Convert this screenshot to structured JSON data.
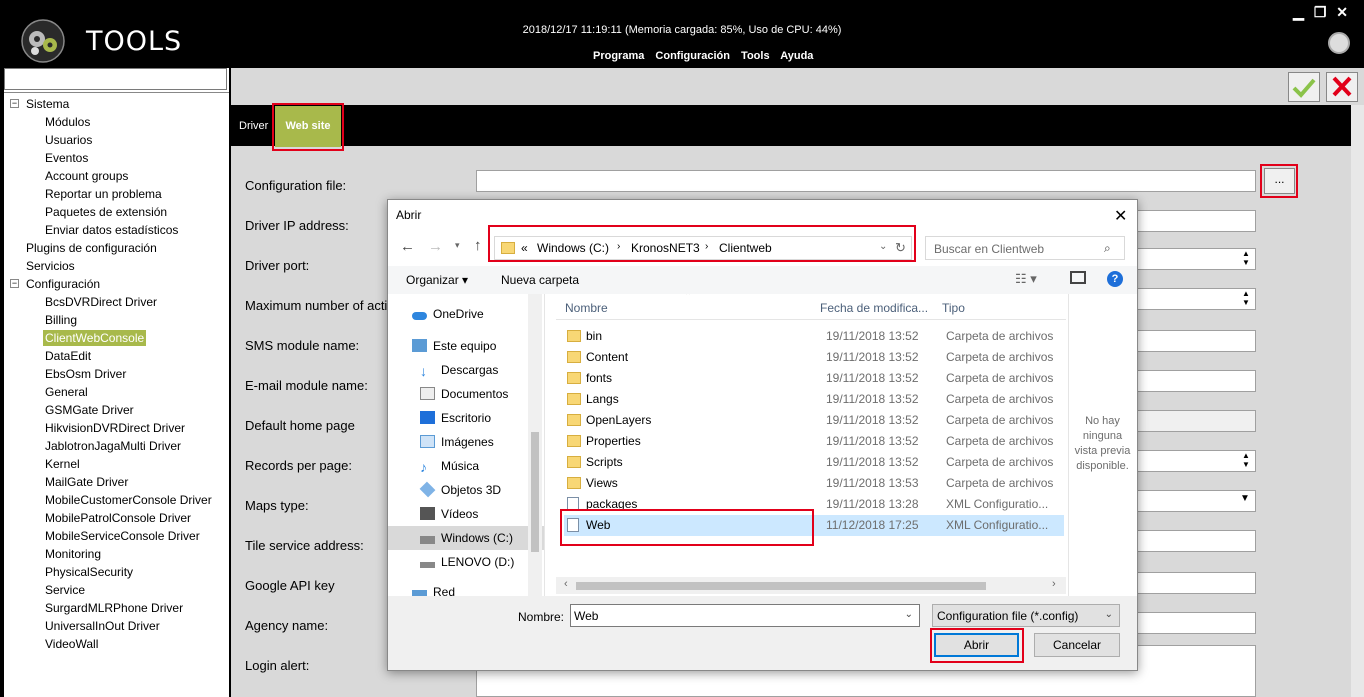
{
  "header": {
    "app_title": "TOOLS",
    "datetime_status": "2018/12/17 11:19:11 (Memoria cargada: 85%, Uso de CPU: 44%)",
    "menu": [
      "Programa",
      "Configuración",
      "Tools",
      "Ayuda"
    ]
  },
  "tree": {
    "sistema": {
      "label": "Sistema",
      "children": [
        "Módulos",
        "Usuarios",
        "Eventos",
        "Account groups",
        "Reportar un problema",
        "Paquetes de extensión",
        "Enviar datos estadísticos"
      ]
    },
    "plugins": "Plugins de configuración",
    "servicios": "Servicios",
    "configuracion": {
      "label": "Configuración",
      "children": [
        "BcsDVRDirect Driver",
        "Billing",
        "ClientWebConsole",
        "DataEdit",
        "EbsOsm Driver",
        "General",
        "GSMGate Driver",
        "HikvisionDVRDirect Driver",
        "JablotronJagaMulti Driver",
        "Kernel",
        "MailGate Driver",
        "MobileCustomerConsole Driver",
        "MobilePatrolConsole Driver",
        "MobileServiceConsole Driver",
        "Monitoring",
        "PhysicalSecurity",
        "Service",
        "SurgardMLRPhone Driver",
        "UniversalInOut Driver",
        "VideoWall"
      ]
    },
    "selected": "ClientWebConsole"
  },
  "tabs": {
    "driver": "Driver",
    "website": "Web site"
  },
  "form": {
    "labels": [
      "Configuration file:",
      "Driver IP address:",
      "Driver port:",
      "Maximum number of acti",
      "SMS module name:",
      "E-mail module name:",
      "Default home page",
      "Records per page:",
      "Maps type:",
      "Tile service address:",
      "Google API key",
      "Agency name:",
      "Login alert:"
    ],
    "browse_label": "..."
  },
  "dialog": {
    "title": "Abrir",
    "close": "✕",
    "path": [
      "«",
      "Windows (C:)",
      "KronosNET3",
      "Clientweb"
    ],
    "search_placeholder": "Buscar en Clientweb",
    "toolbar": {
      "organize": "Organizar ▾",
      "new_folder": "Nueva carpeta"
    },
    "nav": [
      "OneDrive",
      "Este equipo",
      "Descargas",
      "Documentos",
      "Escritorio",
      "Imágenes",
      "Música",
      "Objetos 3D",
      "Vídeos",
      "Windows (C:)",
      "LENOVO (D:)",
      "Red"
    ],
    "columns": {
      "name": "Nombre",
      "date": "Fecha de modifica...",
      "type": "Tipo"
    },
    "files": [
      {
        "name": "bin",
        "date": "19/11/2018 13:52",
        "type": "Carpeta de archivos",
        "kind": "folder"
      },
      {
        "name": "Content",
        "date": "19/11/2018 13:52",
        "type": "Carpeta de archivos",
        "kind": "folder"
      },
      {
        "name": "fonts",
        "date": "19/11/2018 13:52",
        "type": "Carpeta de archivos",
        "kind": "folder"
      },
      {
        "name": "Langs",
        "date": "19/11/2018 13:52",
        "type": "Carpeta de archivos",
        "kind": "folder"
      },
      {
        "name": "OpenLayers",
        "date": "19/11/2018 13:52",
        "type": "Carpeta de archivos",
        "kind": "folder"
      },
      {
        "name": "Properties",
        "date": "19/11/2018 13:52",
        "type": "Carpeta de archivos",
        "kind": "folder"
      },
      {
        "name": "Scripts",
        "date": "19/11/2018 13:52",
        "type": "Carpeta de archivos",
        "kind": "folder"
      },
      {
        "name": "Views",
        "date": "19/11/2018 13:53",
        "type": "Carpeta de archivos",
        "kind": "folder"
      },
      {
        "name": "packages",
        "date": "19/11/2018 13:28",
        "type": "XML Configuratio...",
        "kind": "xml"
      },
      {
        "name": "Web",
        "date": "11/12/2018 17:25",
        "type": "XML Configuratio...",
        "kind": "xml"
      }
    ],
    "selected_file": "Web",
    "preview_text": "No hay ninguna vista previa disponible.",
    "filename_label": "Nombre:",
    "filename_value": "Web",
    "filter": "Configuration file (*.config)",
    "open_button": "Abrir",
    "cancel_button": "Cancelar"
  },
  "colors": {
    "accent": "#a8b94b",
    "highlight": "#e2001a",
    "selection": "#cce8ff"
  }
}
